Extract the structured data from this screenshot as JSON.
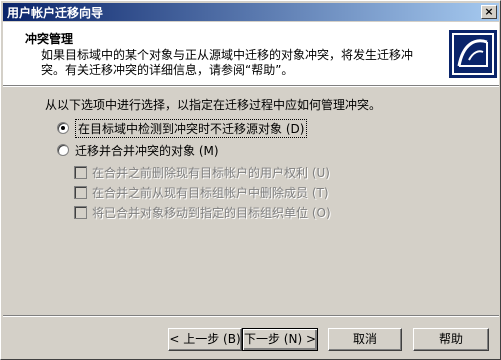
{
  "window": {
    "title": "用户帐户迁移向导",
    "close_glyph": "×"
  },
  "header": {
    "title": "冲突管理",
    "description": "如果目标域中的某个对象与正从源域中迁移的对象冲突，将发生迁移冲突。有关迁移冲突的详细信息，请参阅“帮助”。",
    "logo_icon": "migration-wizard-icon"
  },
  "main": {
    "prompt": "从以下选项中进行选择，以指定在迁移过程中应如何管理冲突。",
    "options": [
      {
        "label": "在目标域中检测到冲突时不迁移源对象 (D)",
        "checked": true
      },
      {
        "label": "迁移并合并冲突的对象 (M)",
        "checked": false
      }
    ],
    "sub_options": [
      {
        "label": "在合并之前删除现有目标帐户的用户权利 (U)",
        "checked": false,
        "enabled": false
      },
      {
        "label": "在合并之前从现有目标组帐户中删除成员 (T)",
        "checked": false,
        "enabled": false
      },
      {
        "label": "将已合并对象移动到指定的目标组织单位 (O)",
        "checked": false,
        "enabled": false
      }
    ]
  },
  "buttons": {
    "back": "< 上一步 (B)",
    "next": "下一步 (N) >",
    "cancel": "取消",
    "help": "帮助"
  },
  "colors": {
    "title_start": "#0a246a",
    "title_end": "#a6caf0",
    "face": "#d4d0c8",
    "logo_bg": "#0a246a"
  }
}
